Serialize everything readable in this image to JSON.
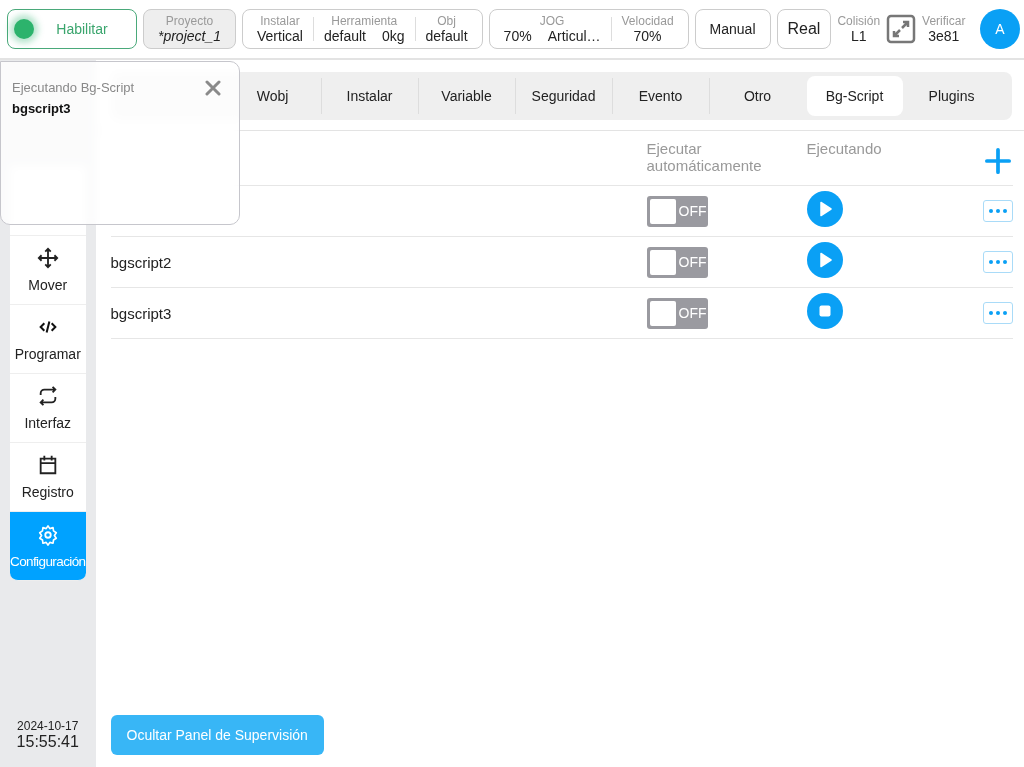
{
  "top_bar": {
    "enable": {
      "label": "Habilitar",
      "on": true
    },
    "project": {
      "label": "Proyecto",
      "value": "*project_1"
    },
    "groups": [
      {
        "fields": [
          {
            "label": "Instalar",
            "values": [
              "Vertical"
            ]
          },
          {
            "label": "Herramienta",
            "values": [
              "default",
              "0kg"
            ]
          },
          {
            "label": "Obj",
            "values": [
              "default"
            ]
          }
        ]
      },
      {
        "fields": [
          {
            "label": "JOG",
            "values": [
              "70%",
              "Articul…"
            ]
          },
          {
            "label": "Velocidad",
            "values": [
              "70%"
            ]
          }
        ]
      }
    ],
    "mode_buttons": [
      "Manual",
      "Real"
    ],
    "collision": {
      "label": "Colisión",
      "value": "L1"
    },
    "verify": {
      "label": "Verificar",
      "value": "3e81"
    },
    "avatar": "A"
  },
  "sidebar": {
    "items": [
      {
        "label": "Mover",
        "selected": false
      },
      {
        "label": "Programar",
        "selected": false
      },
      {
        "label": "Interfaz",
        "selected": false
      },
      {
        "label": "Registro",
        "selected": false
      },
      {
        "label": "Configuración",
        "selected": true
      }
    ],
    "date": "2024-10-17",
    "time": "15:55:41"
  },
  "tabs": [
    {
      "label": "Wobj",
      "selected": false
    },
    {
      "label": "Instalar",
      "selected": false
    },
    {
      "label": "Variable",
      "selected": false
    },
    {
      "label": "Seguridad",
      "selected": false
    },
    {
      "label": "Evento",
      "selected": false
    },
    {
      "label": "Otro",
      "selected": false
    },
    {
      "label": "Bg-Script",
      "selected": true
    },
    {
      "label": "Plugins",
      "selected": false
    }
  ],
  "table": {
    "columns": [
      "Ejecutar automáticamente",
      "Ejecutando"
    ],
    "rows": [
      {
        "auto": false,
        "toggle_text": "OFF",
        "running": false
      },
      {
        "name": "bgscript2",
        "auto": false,
        "toggle_text": "OFF",
        "running": false
      },
      {
        "name": "bgscript3",
        "auto": false,
        "toggle_text": "OFF",
        "running": true
      }
    ]
  },
  "hide_button": "Ocultar Panel de Supervisión",
  "popup": {
    "title": "Ejecutando Bg-Script",
    "script": "bgscript3"
  }
}
